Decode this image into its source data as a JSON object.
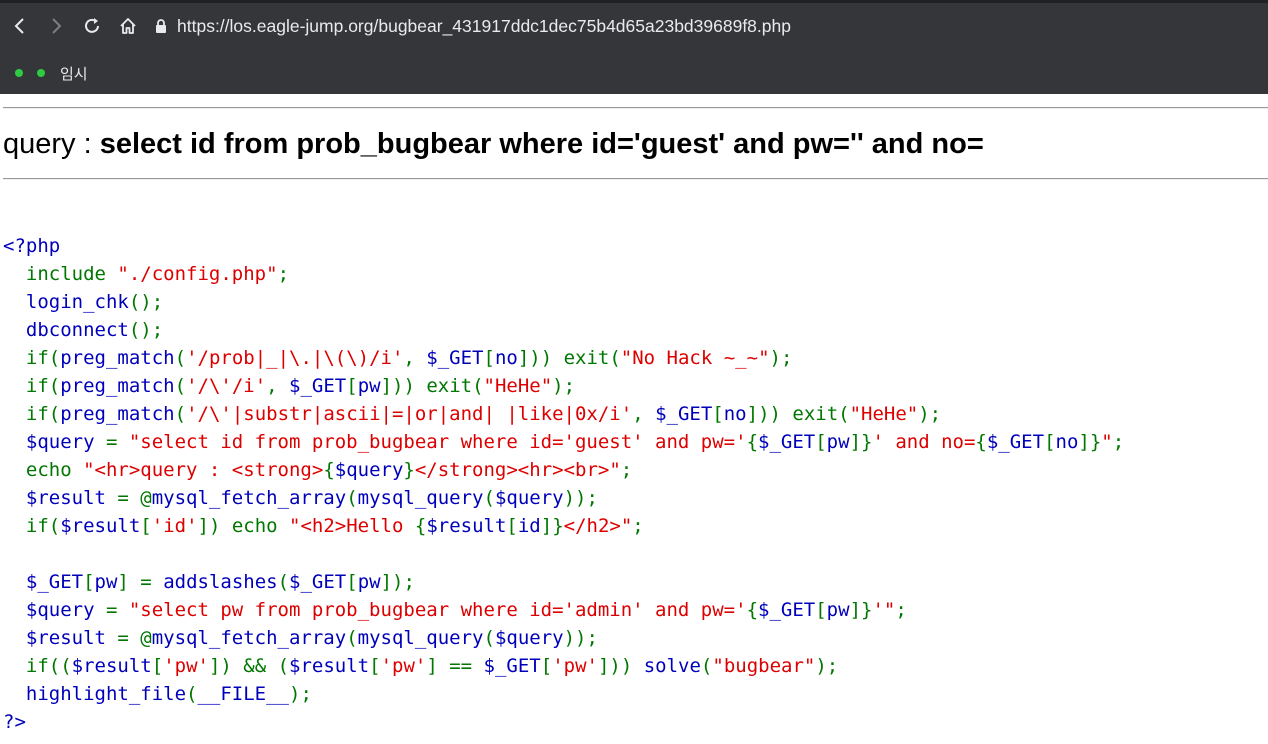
{
  "browser": {
    "url": "https://los.eagle-jump.org/bugbear_431917ddc1dec75b4d65a23bd39689f8.php",
    "bookmark_label": "임시",
    "icons": [
      "back-icon",
      "forward-icon",
      "reload-icon",
      "home-icon",
      "lock-icon"
    ]
  },
  "page": {
    "query_label": "query : ",
    "query_text": "select id from prob_bugbear where id='guest' and pw='' and no="
  },
  "code": {
    "lines": [
      [
        [
          "d",
          "<?php"
        ]
      ],
      [
        [
          "d",
          "  "
        ],
        [
          "k",
          "include "
        ],
        [
          "s",
          "\"./config.php\""
        ],
        [
          "k",
          ";"
        ]
      ],
      [
        [
          "d",
          "  login_chk"
        ],
        [
          "k",
          "();"
        ]
      ],
      [
        [
          "d",
          "  dbconnect"
        ],
        [
          "k",
          "();"
        ]
      ],
      [
        [
          "d",
          "  "
        ],
        [
          "k",
          "if("
        ],
        [
          "d",
          "preg_match"
        ],
        [
          "k",
          "("
        ],
        [
          "s",
          "'/prob|_|\\.|\\(\\)/i'"
        ],
        [
          "k",
          ", "
        ],
        [
          "d",
          "$_GET"
        ],
        [
          "k",
          "["
        ],
        [
          "d",
          "no"
        ],
        [
          "k",
          "])) exit("
        ],
        [
          "s",
          "\"No Hack ~_~\""
        ],
        [
          "k",
          ");"
        ]
      ],
      [
        [
          "d",
          "  "
        ],
        [
          "k",
          "if("
        ],
        [
          "d",
          "preg_match"
        ],
        [
          "k",
          "("
        ],
        [
          "s",
          "'/\\'/i'"
        ],
        [
          "k",
          ", "
        ],
        [
          "d",
          "$_GET"
        ],
        [
          "k",
          "["
        ],
        [
          "d",
          "pw"
        ],
        [
          "k",
          "])) exit("
        ],
        [
          "s",
          "\"HeHe\""
        ],
        [
          "k",
          ");"
        ]
      ],
      [
        [
          "d",
          "  "
        ],
        [
          "k",
          "if("
        ],
        [
          "d",
          "preg_match"
        ],
        [
          "k",
          "("
        ],
        [
          "s",
          "'/\\'|substr|ascii|=|or|and| |like|0x/i'"
        ],
        [
          "k",
          ", "
        ],
        [
          "d",
          "$_GET"
        ],
        [
          "k",
          "["
        ],
        [
          "d",
          "no"
        ],
        [
          "k",
          "])) exit("
        ],
        [
          "s",
          "\"HeHe\""
        ],
        [
          "k",
          ");"
        ]
      ],
      [
        [
          "d",
          "  $query "
        ],
        [
          "k",
          "= "
        ],
        [
          "s",
          "\"select id from prob_bugbear where id='guest' and pw='"
        ],
        [
          "k",
          "{"
        ],
        [
          "d",
          "$_GET"
        ],
        [
          "k",
          "["
        ],
        [
          "d",
          "pw"
        ],
        [
          "k",
          "]}"
        ],
        [
          "s",
          "' and no="
        ],
        [
          "k",
          "{"
        ],
        [
          "d",
          "$_GET"
        ],
        [
          "k",
          "["
        ],
        [
          "d",
          "no"
        ],
        [
          "k",
          "]}"
        ],
        [
          "s",
          "\""
        ],
        [
          "k",
          ";"
        ]
      ],
      [
        [
          "d",
          "  "
        ],
        [
          "k",
          "echo "
        ],
        [
          "s",
          "\"<hr>query : <strong>"
        ],
        [
          "k",
          "{"
        ],
        [
          "d",
          "$query"
        ],
        [
          "k",
          "}"
        ],
        [
          "s",
          "</strong><hr><br>\""
        ],
        [
          "k",
          ";"
        ]
      ],
      [
        [
          "d",
          "  $result "
        ],
        [
          "k",
          "= @"
        ],
        [
          "d",
          "mysql_fetch_array"
        ],
        [
          "k",
          "("
        ],
        [
          "d",
          "mysql_query"
        ],
        [
          "k",
          "("
        ],
        [
          "d",
          "$query"
        ],
        [
          "k",
          "));"
        ]
      ],
      [
        [
          "d",
          "  "
        ],
        [
          "k",
          "if("
        ],
        [
          "d",
          "$result"
        ],
        [
          "k",
          "["
        ],
        [
          "s",
          "'id'"
        ],
        [
          "k",
          "]) echo "
        ],
        [
          "s",
          "\"<h2>Hello "
        ],
        [
          "k",
          "{"
        ],
        [
          "d",
          "$result"
        ],
        [
          "k",
          "["
        ],
        [
          "d",
          "id"
        ],
        [
          "k",
          "]}"
        ],
        [
          "s",
          "</h2>\""
        ],
        [
          "k",
          ";"
        ]
      ],
      [
        [
          "d",
          ""
        ]
      ],
      [
        [
          "d",
          "  $_GET"
        ],
        [
          "k",
          "["
        ],
        [
          "d",
          "pw"
        ],
        [
          "k",
          "] = "
        ],
        [
          "d",
          "addslashes"
        ],
        [
          "k",
          "("
        ],
        [
          "d",
          "$_GET"
        ],
        [
          "k",
          "["
        ],
        [
          "d",
          "pw"
        ],
        [
          "k",
          "]);"
        ]
      ],
      [
        [
          "d",
          "  $query "
        ],
        [
          "k",
          "= "
        ],
        [
          "s",
          "\"select pw from prob_bugbear where id='admin' and pw='"
        ],
        [
          "k",
          "{"
        ],
        [
          "d",
          "$_GET"
        ],
        [
          "k",
          "["
        ],
        [
          "d",
          "pw"
        ],
        [
          "k",
          "]}"
        ],
        [
          "s",
          "'\""
        ],
        [
          "k",
          ";"
        ]
      ],
      [
        [
          "d",
          "  $result "
        ],
        [
          "k",
          "= @"
        ],
        [
          "d",
          "mysql_fetch_array"
        ],
        [
          "k",
          "("
        ],
        [
          "d",
          "mysql_query"
        ],
        [
          "k",
          "("
        ],
        [
          "d",
          "$query"
        ],
        [
          "k",
          "));"
        ]
      ],
      [
        [
          "d",
          "  "
        ],
        [
          "k",
          "if(("
        ],
        [
          "d",
          "$result"
        ],
        [
          "k",
          "["
        ],
        [
          "s",
          "'pw'"
        ],
        [
          "k",
          "]) && ("
        ],
        [
          "d",
          "$result"
        ],
        [
          "k",
          "["
        ],
        [
          "s",
          "'pw'"
        ],
        [
          "k",
          "] == "
        ],
        [
          "d",
          "$_GET"
        ],
        [
          "k",
          "["
        ],
        [
          "s",
          "'pw'"
        ],
        [
          "k",
          "])) "
        ],
        [
          "d",
          "solve"
        ],
        [
          "k",
          "("
        ],
        [
          "s",
          "\"bugbear\""
        ],
        [
          "k",
          ");"
        ]
      ],
      [
        [
          "d",
          "  highlight_file"
        ],
        [
          "k",
          "("
        ],
        [
          "d",
          "__FILE__"
        ],
        [
          "k",
          ");"
        ]
      ],
      [
        [
          "d",
          "?>"
        ]
      ]
    ]
  }
}
